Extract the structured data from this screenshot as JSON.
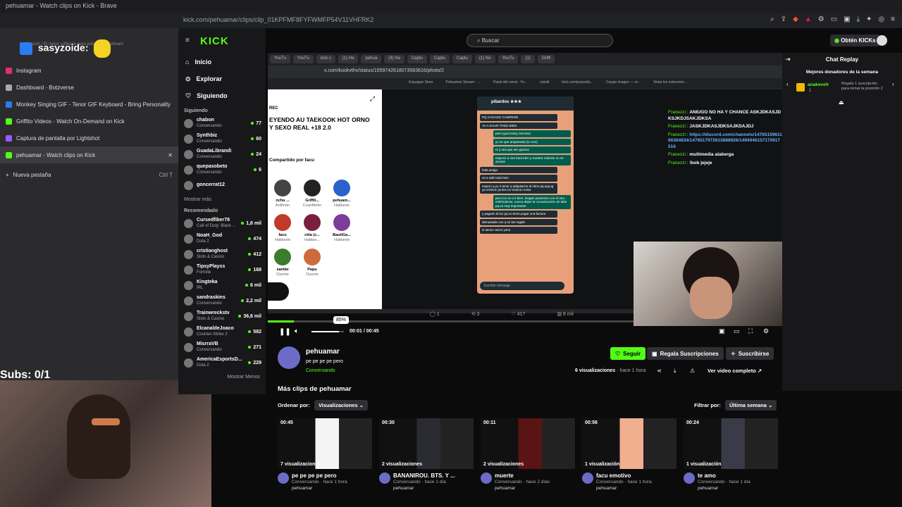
{
  "browser": {
    "window_title": "pehuamar - Watch clips on Kick - Brave",
    "address": "kick.com/pehuamar/clips/clip_01KPFMF8FYFWMFP54V11VHFRK2",
    "overlay_url": "https://kick.com/pehuamar/clips/clip_01KPFMF8FYFWMFP54V11VHFRK2",
    "tabs": [
      {
        "label": "Instagram",
        "color": "#e1306c"
      },
      {
        "label": "Dashboard - Botzverse",
        "color": "#aaaaaa"
      },
      {
        "label": "Monkey Singing GIF - Tenor GIF Keyboard - Bring Personality",
        "color": "#2a7cf0"
      },
      {
        "label": "Griffito Videos - Watch On-Demand on Kick",
        "color": "#53fc18"
      },
      {
        "label": "Captura de pantalla por Lightshot",
        "color": "#9b59ff"
      },
      {
        "label": "pehuamar - Watch clips on Kick",
        "color": "#53fc18"
      }
    ],
    "new_tab_label": "Nueva pestaña",
    "new_tab_shortcut": "Ctrl T"
  },
  "stream_overlay": {
    "streamer_handle": "sasyzoide:",
    "subs": "Subs: 0/1",
    "tagline": "Innovación | El mejor software para potenciar tu stream"
  },
  "kick": {
    "logo": "KICK",
    "nav": [
      {
        "label": "Inicio",
        "icon": "home-icon"
      },
      {
        "label": "Explorar",
        "icon": "compass-icon"
      },
      {
        "label": "Siguiendo",
        "icon": "heart-icon"
      }
    ],
    "following_title": "Siguiendo",
    "following": [
      {
        "name": "chabon",
        "sub": "Conversando",
        "count": "77"
      },
      {
        "name": "Synthbiz",
        "sub": "Conversando",
        "count": "60"
      },
      {
        "name": "GuadaLibrandi",
        "sub": "Conversando",
        "count": "24"
      },
      {
        "name": "quepasobeto",
        "sub": "Conversando",
        "count": "6"
      },
      {
        "name": "goncerrat12",
        "sub": "",
        "count": ""
      }
    ],
    "show_more": "Mostrar más",
    "recommended_title": "Recomendado",
    "recommended": [
      {
        "name": "Cursedfiber78",
        "sub": "Call of Duty: Black ...",
        "count": "1,8 mil"
      },
      {
        "name": "NoaH_God",
        "sub": "Dota 2",
        "count": "474"
      },
      {
        "name": "cristianghost",
        "sub": "Slots & Casino",
        "count": "412"
      },
      {
        "name": "TipsyPlayss",
        "sub": "Fortnite",
        "count": "168"
      },
      {
        "name": "Kingteka",
        "sub": "IRL",
        "count": "6 mil"
      },
      {
        "name": "sandraskins",
        "sub": "Conversando",
        "count": "2,2 mil"
      },
      {
        "name": "Trainwreckstv",
        "sub": "Slots & Casino",
        "count": "36,6 mil"
      },
      {
        "name": "ElcanaldeJoaco",
        "sub": "Counter-Strike 2",
        "count": "582"
      },
      {
        "name": "MisrraVB",
        "sub": "Conversando",
        "count": "271"
      },
      {
        "name": "AmericaEsportsD...",
        "sub": "Dota 2",
        "count": "229"
      }
    ],
    "show_less": "Mostrar Menos",
    "search_placeholder": "Buscar",
    "obten_kicks": "Obtén KICKs"
  },
  "video": {
    "inner_tabs": [
      "YouTu",
      "YouTu",
      "kick.c",
      "(1) Ha",
      "pehua",
      "(4) Ha",
      "Captu",
      "Captu",
      "Captu",
      "(1) No",
      "YouTu",
      "(1)",
      "Griffi"
    ],
    "inner_address": "x.com/kookvthv/status/1659742618073583616/photo/2",
    "bookmarks": [
      "Enjuague Store",
      "Pehuamar Stream - ...",
      "Panel del canal - Yo...",
      "cobalt",
      "kick.com/popout/p...",
      "Cargar imagen — re...",
      "Notar los instrumen..."
    ],
    "tweet_text": "EYENDO AU TAEKOOK HOT ORNO Y SEXO REAL +18 2.0",
    "shared_by": "Compartido por facu",
    "space_people": [
      {
        "name": "nchu ...",
        "role": "Anfitrión"
      },
      {
        "name": "Griffit...",
        "role": "Coanfitrión"
      },
      {
        "name": "pehuam...",
        "role": "Hablante"
      },
      {
        "name": "facu",
        "role": "Hablante"
      },
      {
        "name": "ckla (c...",
        "role": "Hablan..."
      },
      {
        "name": "BautiGa...",
        "role": "Hablante"
      },
      {
        "name": "santiw",
        "role": "Oyente"
      },
      {
        "name": "Papu",
        "role": "Oyente"
      }
    ],
    "phone_chat_name": "pibardos ★★★",
    "phone_messages": [
      "PQ CAGADO CAMPEON",
      "VA A SALIR TODO BIEN",
      "pero igual estoy nervioso",
      "yo se que ampaneda (no veo)",
      "ni q sea que ser ypunca",
      "esperar a una hora bien y nuestra relación no se arruine",
      "hola amigo",
      "va a salir todo bien",
      "espero q yo ri tener q adaptarme al ritmo pq aquog ya vivieron juntos no vivieron solos",
      "pero los ve a ir bien, tengan paciencia con el otro, entiéndanse, nunca dejen la comunicación de lado pq es muy importante",
      "y paguen la luz pq no tiene pogar una factura",
      "demasiado con q se las regale",
      "si tienen razon yooo"
    ],
    "phone_input": "Escribir mensaje",
    "chat_overlay": [
      {
        "user": "Franezzi",
        "text": "ANIUGO NO HA Y CHANCE ASKJDKASJDKSJKDJSAKJDKSA"
      },
      {
        "user": "Franezzi",
        "text": "JASKJDKASJDKSAJKDAJDJ"
      },
      {
        "user": "Franezzi",
        "text": "https://discord.com/channels/1476515961166364834/1476517972615888926/1494946157170917516"
      },
      {
        "user": "Franezzi",
        "text": "multimedia alaberga"
      },
      {
        "user": "Franezzi",
        "text": "!bob jejeje"
      }
    ],
    "tweet_actions": [
      "1",
      "3",
      "417",
      "8 mil"
    ],
    "volume_tooltip": "85%",
    "volume": 0.85,
    "progress": 0.05,
    "time": "00:01 / 00:45"
  },
  "clip": {
    "channel": "pehuamar",
    "title": "pe pe pe pe pero",
    "category": "Conversando",
    "follow": "Seguir",
    "gift": "Regala Suscripciones",
    "subscribe": "Suscribirse",
    "views": "6 visualizaciones",
    "age": "hace 1 hora",
    "full_video": "Ver video completo"
  },
  "more_clips": {
    "heading": "Más clips de pehuamar",
    "sort_label": "Ordenar por:",
    "sort_value": "Visualizaciones",
    "filter_label": "Filtrar por:",
    "filter_value": "Última semana",
    "items": [
      {
        "duration": "00:45",
        "views": "7 visualizaciones",
        "title": "pe pe pe pe pero",
        "meta": "Conversando · hace 1 hora",
        "channel": "pehuamar"
      },
      {
        "duration": "00:30",
        "views": "2 visualizaciones",
        "title": "BANANIROU. BTS. Y ...",
        "meta": "Conversando · hace 1 día",
        "channel": "pehuamar"
      },
      {
        "duration": "00:11",
        "views": "2 visualizaciones",
        "title": "muerte",
        "meta": "Conversando · hace 2 días",
        "channel": "pehuamar"
      },
      {
        "duration": "00:56",
        "views": "1 visualización",
        "title": "facu emotivo",
        "meta": "Conversando · hace 1 hora",
        "channel": "pehuamar"
      },
      {
        "duration": "00:24",
        "views": "1 visualización",
        "title": "te amo",
        "meta": "Conversando · hace 1 día",
        "channel": "pehuamar"
      }
    ]
  },
  "chat_replay": {
    "title": "Chat Replay",
    "donors_title": "Mejores donadores de la semana",
    "donor": "anakevefr",
    "donor_count": "1",
    "gift_cta": "Regala 1 suscripción para tomar la posición 2"
  },
  "colors": {
    "accent": "#53fc18",
    "bg": "#0b0b0c",
    "panel": "#18181b"
  }
}
